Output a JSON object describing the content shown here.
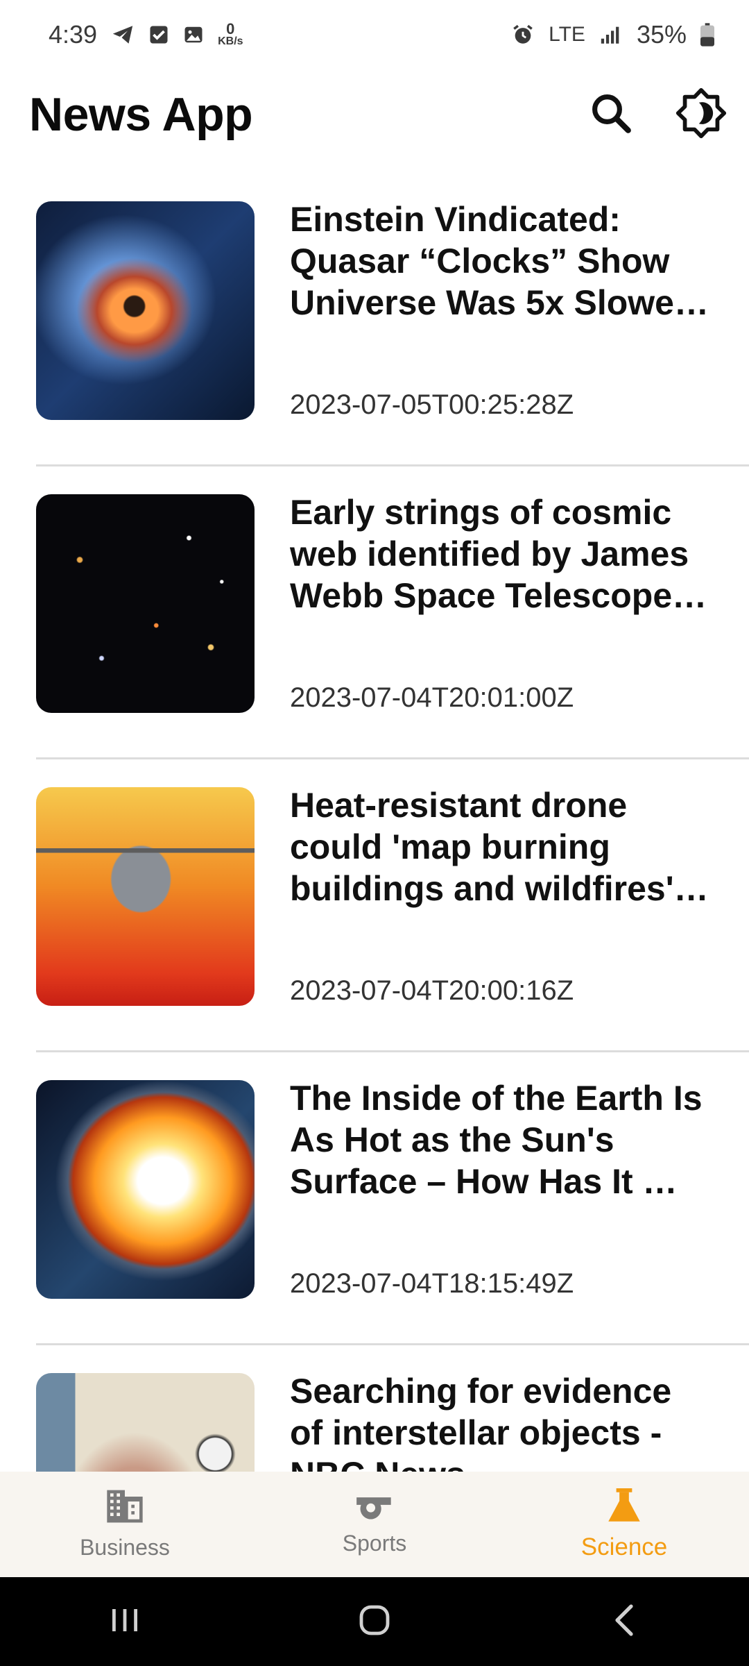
{
  "status_bar": {
    "time": "4:39",
    "data_speed_value": "0",
    "data_speed_unit": "KB/s",
    "network": "LTE",
    "battery": "35%"
  },
  "app_bar": {
    "title": "News App",
    "search_icon": "search-icon",
    "theme_icon": "brightness-icon"
  },
  "articles": [
    {
      "title": "Einstein Vindicated: Quasar “Clocks” Show Universe Was 5x Slower …",
      "date": "2023-07-05T00:25:28Z"
    },
    {
      "title": "Early strings of cosmic web identified by James Webb Space Telescope -…",
      "date": "2023-07-04T20:01:00Z"
    },
    {
      "title": "Heat-resistant drone could 'map burning buildings and wildfires' …",
      "date": "2023-07-04T20:00:16Z"
    },
    {
      "title": "The Inside of the Earth Is As Hot as the Sun's Surface – How Has It …",
      "date": "2023-07-04T18:15:49Z"
    },
    {
      "title": "Searching for evidence of interstellar objects - NBC News",
      "date": ""
    }
  ],
  "bottom_nav": {
    "items": [
      {
        "label": "Business",
        "icon": "building-icon",
        "active": false
      },
      {
        "label": "Sports",
        "icon": "whistle-icon",
        "active": false
      },
      {
        "label": "Science",
        "icon": "flask-icon",
        "active": true
      }
    ]
  },
  "colors": {
    "accent": "#f39c12",
    "nav_background": "#f8f5f0"
  }
}
